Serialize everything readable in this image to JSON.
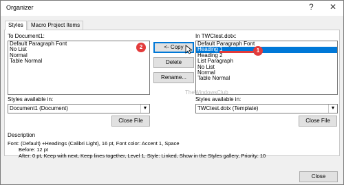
{
  "window": {
    "title": "Organizer"
  },
  "tabs": [
    {
      "label": "Styles",
      "active": true
    },
    {
      "label": "Macro Project Items",
      "active": false
    }
  ],
  "left": {
    "label": "To Document1:",
    "items": [
      "Default Paragraph Font",
      "No List",
      "Normal",
      "Table Normal"
    ],
    "available_label": "Styles available in:",
    "available_value": "Document1 (Document)",
    "close_button": "Close File"
  },
  "right": {
    "label": "In TWCtest.dotx:",
    "items": [
      "Default Paragraph Font",
      "Heading 1",
      "Heading 2",
      "List Paragraph",
      "No List",
      "Normal",
      "Table Normal"
    ],
    "selected_item": "Heading 1",
    "available_label": "Styles available in:",
    "available_value": "TWCtest.dotx (Template)",
    "close_button": "Close File"
  },
  "middle_buttons": [
    "<- Copy",
    "Delete",
    "Rename..."
  ],
  "description": {
    "label": "Description",
    "line1": "Font: (Default) +Headings (Calibri Light), 16 pt, Font color: Accent 1, Space",
    "line2": "Before:  12 pt",
    "line3": "After:  0 pt, Keep with next, Keep lines together, Level 1, Style: Linked, Show in the Styles gallery, Priority: 10"
  },
  "footer": {
    "close_button": "Close"
  },
  "annotations": {
    "badge1": "1",
    "badge2": "2"
  },
  "watermark": "TheWindowsClub",
  "colors": {
    "selection": "#0078d7",
    "annotation": "#e33b3b"
  }
}
